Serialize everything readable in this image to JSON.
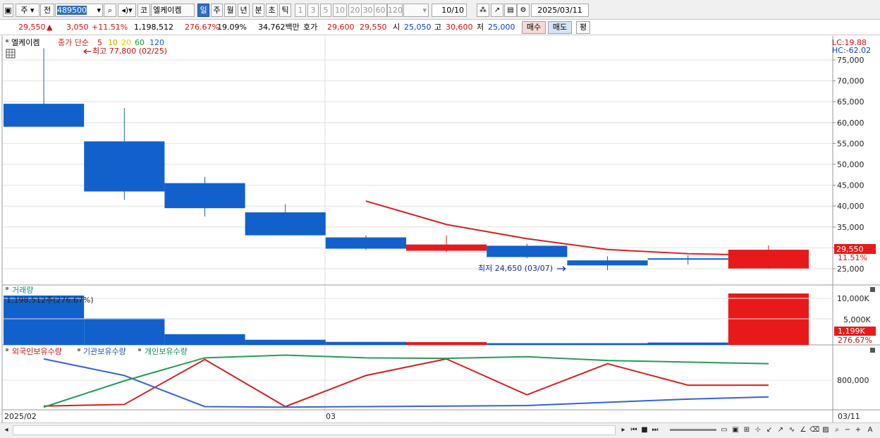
{
  "toolbar": {
    "type_label": "주",
    "prev_label": "전",
    "code": "489500",
    "name_prefix": "코",
    "stock_name": "엘케이켐",
    "periods": [
      "일",
      "주",
      "월",
      "년",
      "분",
      "초",
      "틱"
    ],
    "active_period": "일",
    "intervals": [
      "1",
      "3",
      "5",
      "10",
      "20",
      "30",
      "60",
      "120"
    ],
    "count": "10/10",
    "date": "2025/03/11"
  },
  "info": {
    "price": "29,550",
    "arrow": "▲",
    "change": "3,050",
    "change_pct": "+11.51%",
    "volume": "1,198,512",
    "volume_ratio": "276.67%",
    "turnover": "19.09%",
    "amount": "34,762백만",
    "quote_label": "호가",
    "ask": "29,600",
    "bid": "29,550",
    "open_label": "시",
    "open": "25,050",
    "high_label": "고",
    "high": "30,600",
    "low_label": "저",
    "low": "25,000",
    "buy_label": "매수",
    "sell_label": "매도",
    "avg_label": "평"
  },
  "chart_data": {
    "type": "candlestick",
    "dates": [
      "2025/02",
      "",
      "",
      "",
      "03",
      "",
      "",
      "",
      "",
      "03/11"
    ],
    "series": [
      {
        "open": 59000,
        "high": 77800,
        "low": 59000,
        "close": 64500,
        "color": "blue"
      },
      {
        "open": 55500,
        "high": 63500,
        "low": 41500,
        "close": 43500,
        "color": "blue"
      },
      {
        "open": 45500,
        "high": 47000,
        "low": 37500,
        "close": 39500,
        "color": "blue"
      },
      {
        "open": 38500,
        "high": 40500,
        "low": 33000,
        "close": 33000,
        "color": "blue"
      },
      {
        "open": 32500,
        "high": 33000,
        "low": 29500,
        "close": 29800,
        "color": "blue"
      },
      {
        "open": 29300,
        "high": 33000,
        "low": 29000,
        "close": 30800,
        "color": "red"
      },
      {
        "open": 30500,
        "high": 31000,
        "low": 27500,
        "close": 27800,
        "color": "blue"
      },
      {
        "open": 27000,
        "high": 28000,
        "low": 24650,
        "close": 25800,
        "color": "blue"
      },
      {
        "open": 27500,
        "high": 28200,
        "low": 26000,
        "close": 27200,
        "color": "blue"
      },
      {
        "open": 25050,
        "high": 30600,
        "low": 25000,
        "close": 29550,
        "color": "red"
      }
    ],
    "ma5": [
      null,
      null,
      null,
      null,
      41200,
      35600,
      32200,
      29600,
      28600,
      28200
    ],
    "price_axis": [
      "75,000",
      "70,000",
      "65,000",
      "60,000",
      "55,000",
      "50,000",
      "45,000",
      "40,000",
      "35,000",
      "30,000",
      "25,000"
    ],
    "legend": {
      "title": "엘케이켐",
      "label": "종가 단순",
      "periods": [
        "5",
        "10",
        "20",
        "60",
        "120"
      ]
    },
    "high_note": "최고 77,800 (02/25)",
    "low_note": "최저 24,650 (03/07)",
    "lc": "LC:19.88",
    "hc": "HC:-62.02",
    "current_price": "29,550",
    "current_pct": "11.51%",
    "volume": {
      "title": "거래량",
      "caption": "1,198,512주(276.67%)",
      "values": [
        1150000,
        620000,
        250000,
        120000,
        70000,
        65000,
        40000,
        40000,
        55000,
        1198512
      ],
      "axis": [
        "10,000K",
        "5,000K"
      ],
      "current": "1,199K",
      "current_pct": "276.67%"
    },
    "holdings": {
      "labels": [
        "외국인보유수량",
        "기관보유수량",
        "개인보유수량"
      ],
      "axis": "800,000",
      "foreign": [
        0.03,
        0.06,
        0.9,
        0.02,
        0.6,
        0.91,
        0.24,
        0.82,
        0.42,
        0.42
      ],
      "institution": [
        0.91,
        0.6,
        0.02,
        0.01,
        0.02,
        0.03,
        0.04,
        0.1,
        0.16,
        0.2
      ],
      "individual": [
        0.01,
        0.5,
        0.93,
        0.98,
        0.93,
        0.92,
        0.95,
        0.88,
        0.85,
        0.82
      ]
    }
  }
}
